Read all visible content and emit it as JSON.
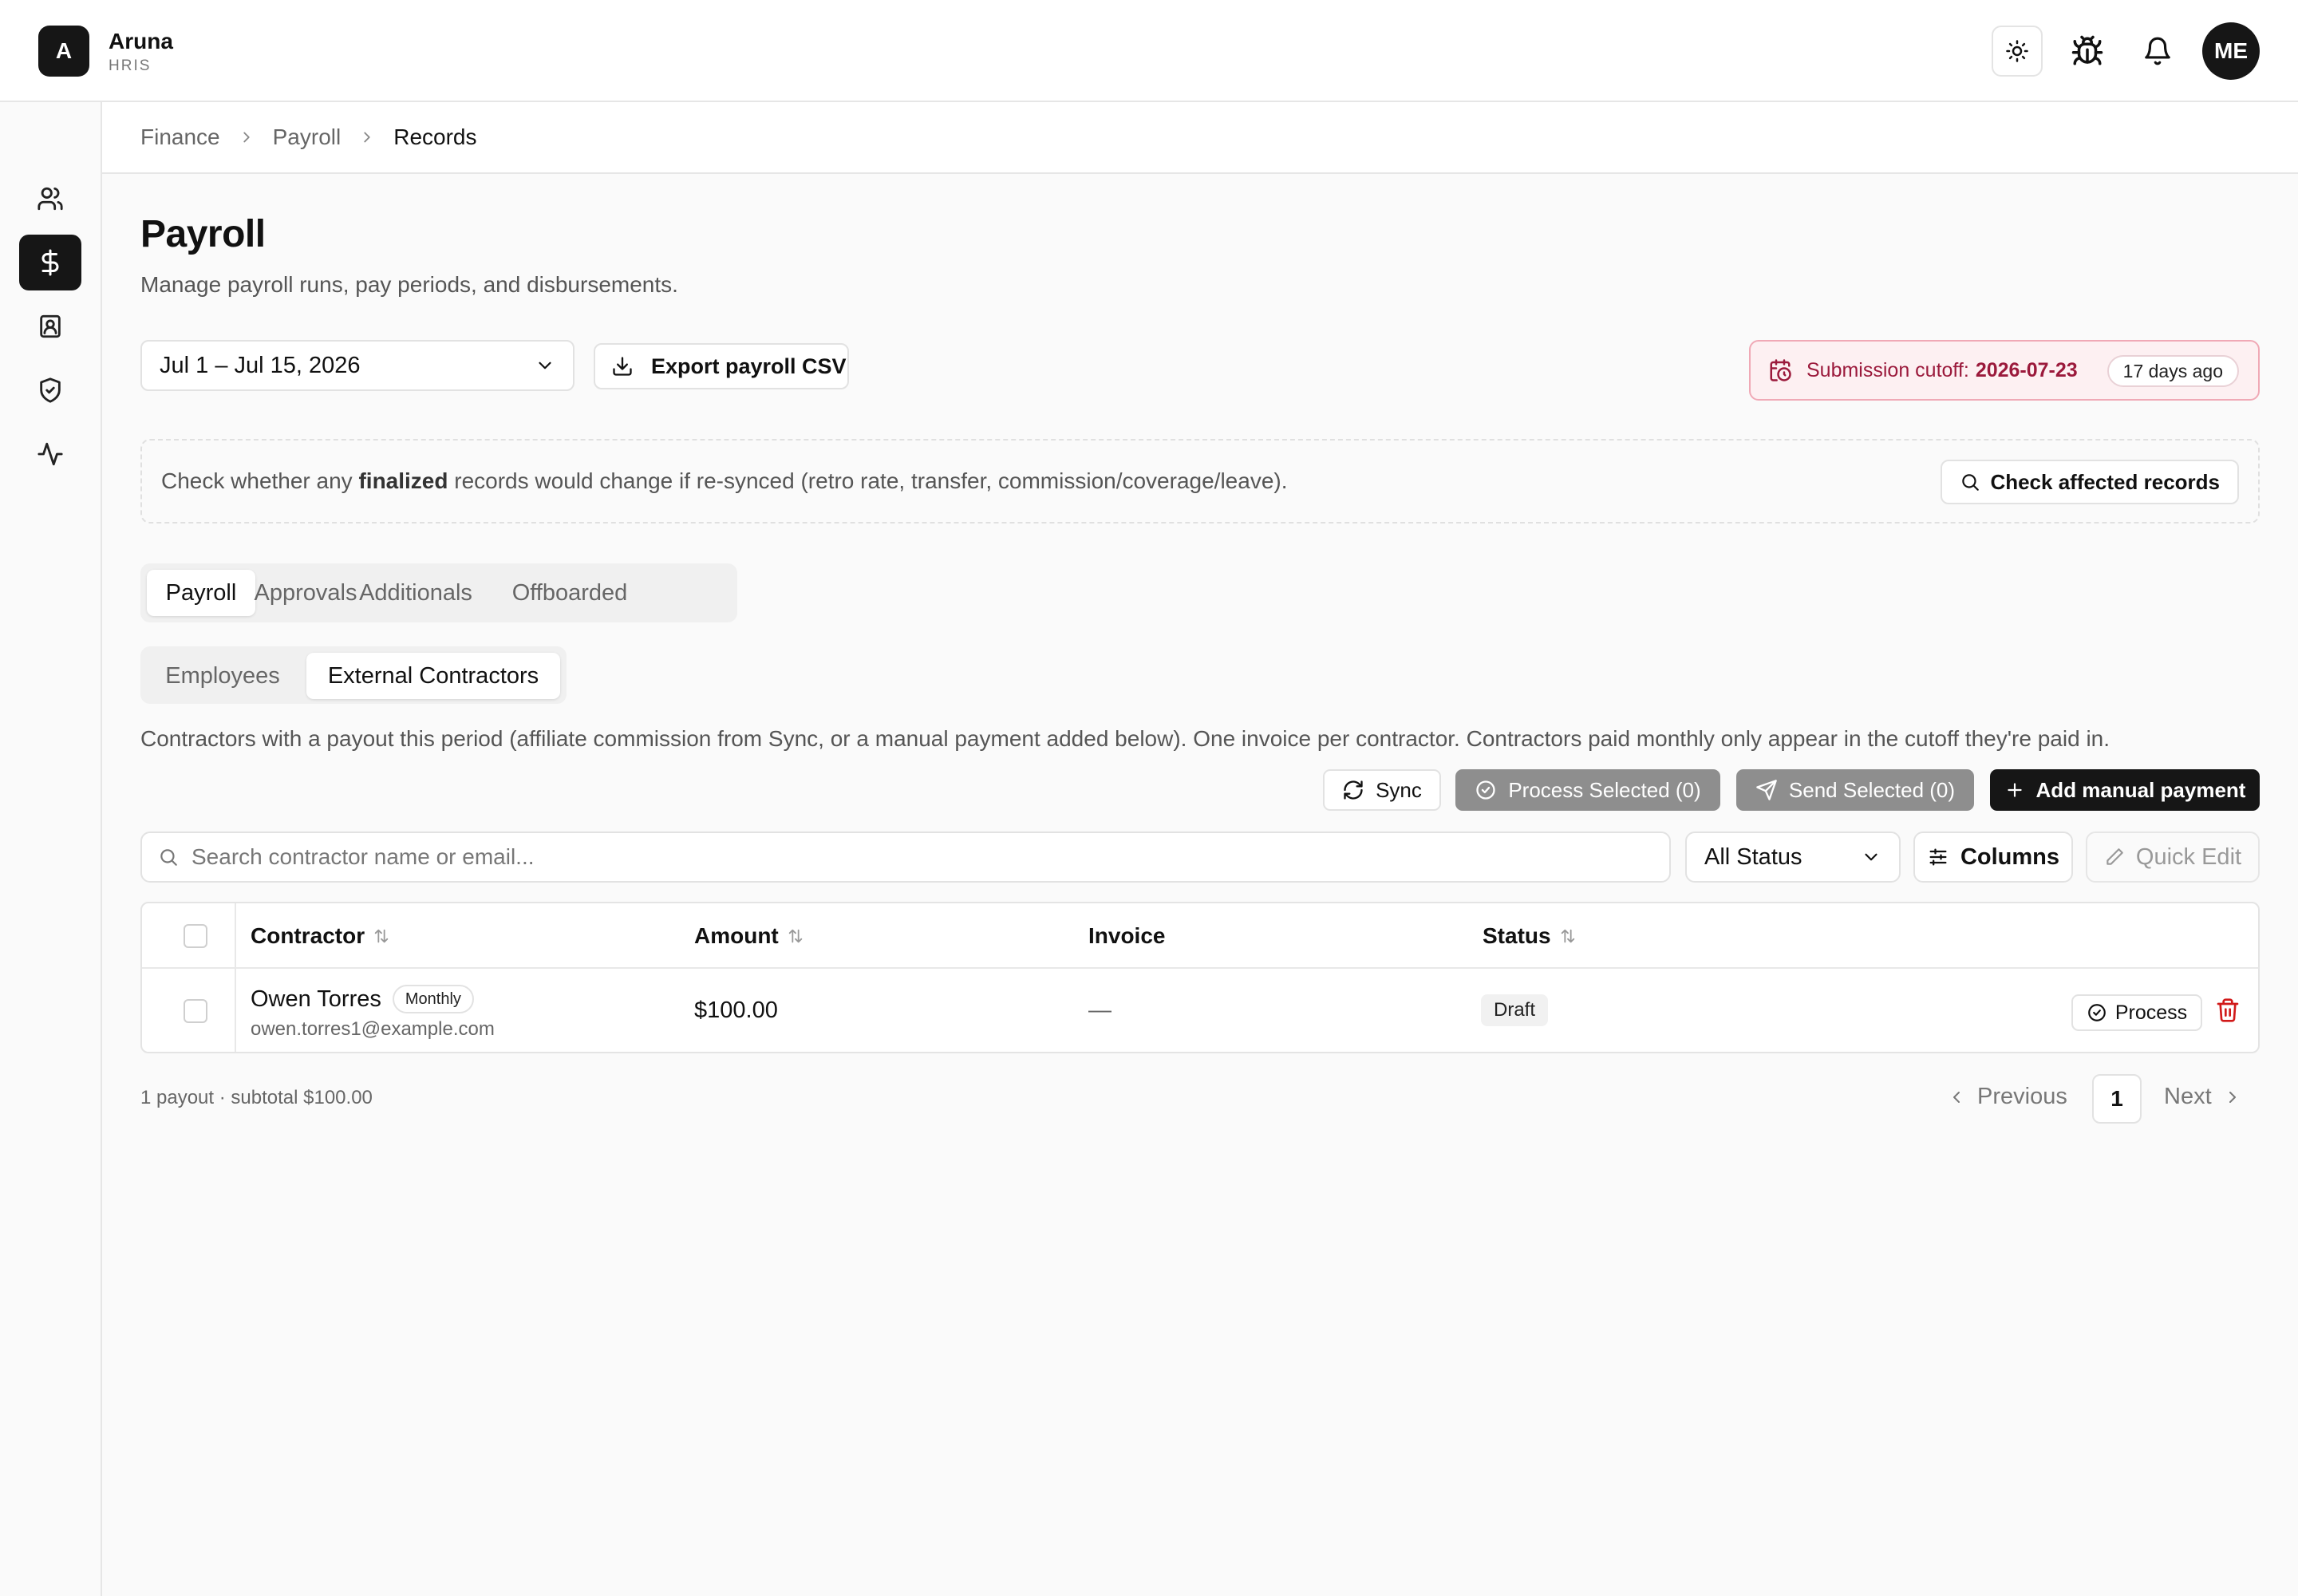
{
  "app": {
    "logo_letter": "A",
    "name": "Aruna",
    "subtitle": "HRIS",
    "user_initials": "ME"
  },
  "icons": {
    "theme": "sun-icon",
    "debug": "bug-icon",
    "notifications": "bell-icon",
    "sidebar": [
      "users-icon",
      "dollar-icon",
      "contact-card-icon",
      "shield-check-icon",
      "activity-icon"
    ]
  },
  "breadcrumb": [
    "Finance",
    "Payroll",
    "Records"
  ],
  "page": {
    "title": "Payroll",
    "subtitle": "Manage payroll runs, pay periods, and disbursements."
  },
  "period": {
    "selected": "Jul 1 – Jul 15, 2026"
  },
  "export_label": "Export payroll CSV",
  "cutoff": {
    "label": "Submission cutoff:",
    "date": "2026-07-23",
    "relative": "17 days ago"
  },
  "notice": {
    "prefix": "Check whether any ",
    "emphasis": "finalized",
    "suffix": " records would change if re-synced (retro rate, transfer, commission/coverage/leave).",
    "button": "Check affected records"
  },
  "tabs": [
    "Payroll",
    "Approvals",
    "Additionals",
    "Offboarded"
  ],
  "subtabs": [
    "Employees",
    "External Contractors"
  ],
  "description": "Contractors with a payout this period (affiliate commission from Sync, or a manual payment added below). One invoice per contractor. Contractors paid monthly only appear in the cutoff they're paid in.",
  "actions": {
    "sync": "Sync",
    "process_selected": "Process Selected (0)",
    "send_selected": "Send Selected (0)",
    "add_manual": "Add manual payment"
  },
  "search": {
    "placeholder": "Search contractor name or email..."
  },
  "status_filter": "All Status",
  "columns_label": "Columns",
  "quick_edit_label": "Quick Edit",
  "table": {
    "headers": {
      "contractor": "Contractor",
      "amount": "Amount",
      "invoice": "Invoice",
      "status": "Status"
    },
    "rows": [
      {
        "name": "Owen Torres",
        "frequency": "Monthly",
        "email": "owen.torres1@example.com",
        "amount": "$100.00",
        "invoice": "—",
        "status": "Draft",
        "action": "Process"
      }
    ]
  },
  "footer": {
    "summary": "1 payout · subtotal $100.00",
    "previous": "Previous",
    "page": "1",
    "next": "Next"
  },
  "colors": {
    "accent": "#161616",
    "cutoff_text": "#9b1a3c",
    "cutoff_bg": "#fdf0f2",
    "danger": "#d11a1a"
  }
}
